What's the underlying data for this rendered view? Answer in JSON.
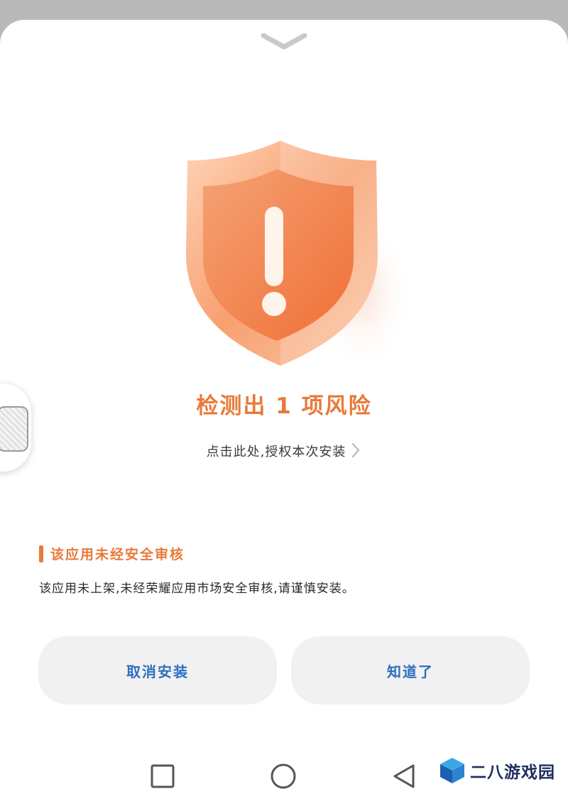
{
  "dialog": {
    "title": "检测出 1 项风险",
    "authorize_link": "点击此处,授权本次安装",
    "warning": {
      "heading": "该应用未经安全审核",
      "body": "该应用未上架,未经荣耀应用市场安全审核,请谨慎安装。"
    },
    "buttons": {
      "cancel": "取消安装",
      "ok": "知道了"
    }
  },
  "watermark": {
    "text": "二八游戏园"
  },
  "icons": {
    "handle": "chevron-down-icon",
    "shield": "warning-shield-icon",
    "chevron": "chevron-right-icon",
    "recent": "square-recent-apps-icon",
    "home": "circle-home-icon",
    "back": "triangle-back-icon"
  },
  "colors": {
    "accent_orange": "#e87a3a",
    "button_text_blue": "#2d6fc0",
    "button_bg": "#f1f1f1",
    "backdrop_gray": "#b9b9b9"
  }
}
